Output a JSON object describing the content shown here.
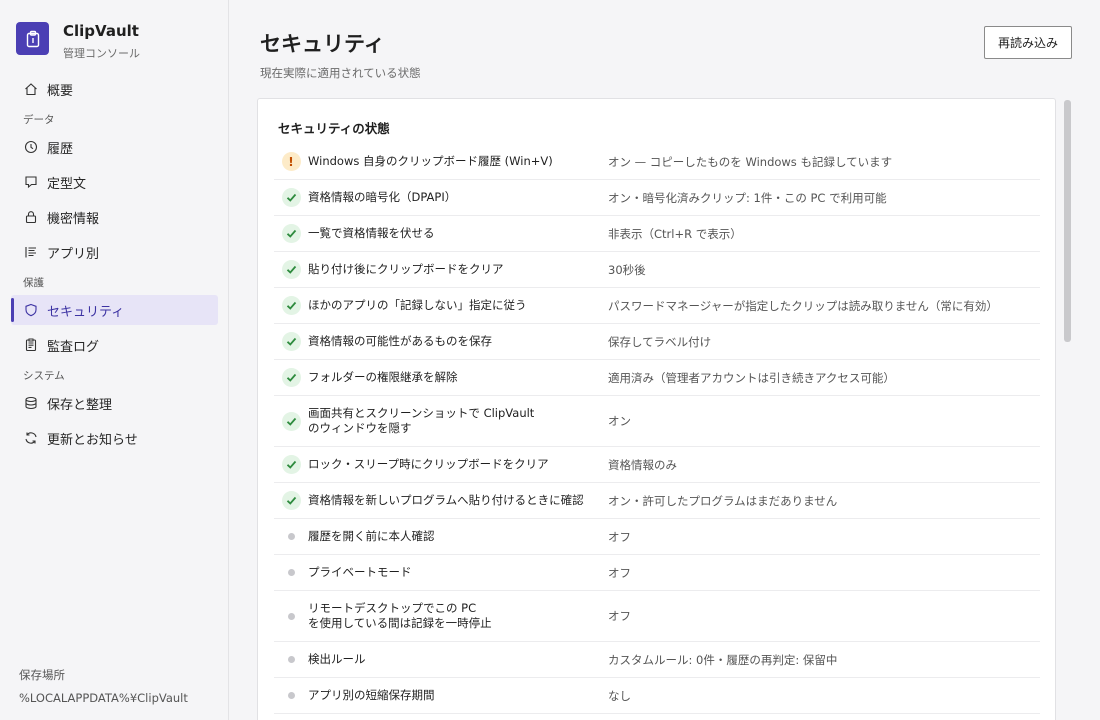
{
  "brand": {
    "name": "ClipVault",
    "subtitle": "管理コンソール"
  },
  "nav": {
    "overview": "概要",
    "section_data": "データ",
    "history": "履歴",
    "templates": "定型文",
    "secrets": "機密情報",
    "by_app": "アプリ別",
    "section_protect": "保護",
    "security": "セキュリティ",
    "audit_log": "監査ログ",
    "section_system": "システム",
    "storage_cleanup": "保存と整理",
    "updates": "更新とお知らせ"
  },
  "storage": {
    "label": "保存場所",
    "path": "%LOCALAPPDATA%¥ClipVault"
  },
  "page": {
    "title": "セキュリティ",
    "subtitle": "現在実際に適用されている状態",
    "reload": "再読み込み"
  },
  "card": {
    "title": "セキュリティの状態",
    "rows": [
      {
        "status": "warning",
        "label": "Windows 自身のクリップボード履歴 (Win+V)",
        "value": "オン — コピーしたものを Windows も記録しています"
      },
      {
        "status": "ok",
        "label": "資格情報の暗号化（DPAPI）",
        "value": "オン・暗号化済みクリップ: 1件・この PC で利用可能"
      },
      {
        "status": "ok",
        "label": "一覧で資格情報を伏せる",
        "value": "非表示（Ctrl+R で表示）"
      },
      {
        "status": "ok",
        "label": "貼り付け後にクリップボードをクリア",
        "value": "30秒後"
      },
      {
        "status": "ok",
        "label": "ほかのアプリの「記録しない」指定に従う",
        "value": "パスワードマネージャーが指定したクリップは読み取りません（常に有効）"
      },
      {
        "status": "ok",
        "label": "資格情報の可能性があるものを保存",
        "value": "保存してラベル付け"
      },
      {
        "status": "ok",
        "label": "フォルダーの権限継承を解除",
        "value": "適用済み（管理者アカウントは引き続きアクセス可能）"
      },
      {
        "status": "ok",
        "label_line1": "画面共有とスクリーンショットで ClipVault",
        "label_line2": "のウィンドウを隠す",
        "value": "オン"
      },
      {
        "status": "ok",
        "label": "ロック・スリープ時にクリップボードをクリア",
        "value": "資格情報のみ"
      },
      {
        "status": "ok",
        "label": "資格情報を新しいプログラムへ貼り付けるときに確認",
        "value": "オン・許可したプログラムはまだありません"
      },
      {
        "status": "off",
        "label": "履歴を開く前に本人確認",
        "value": "オフ"
      },
      {
        "status": "off",
        "label": "プライベートモード",
        "value": "オフ"
      },
      {
        "status": "off",
        "label_line1": "リモートデスクトップでこの PC",
        "label_line2": "を使用している間は記録を一時停止",
        "value": "オフ"
      },
      {
        "status": "off",
        "label": "検出ルール",
        "value": "カスタムルール: 0件・履歴の再判定: 保留中"
      },
      {
        "status": "off",
        "label": "アプリ別の短縮保存期間",
        "value": "なし"
      }
    ]
  },
  "colors": {
    "accent": "#4b3fb4",
    "ok": "#2e8b3e",
    "warning": "#c24e00"
  }
}
